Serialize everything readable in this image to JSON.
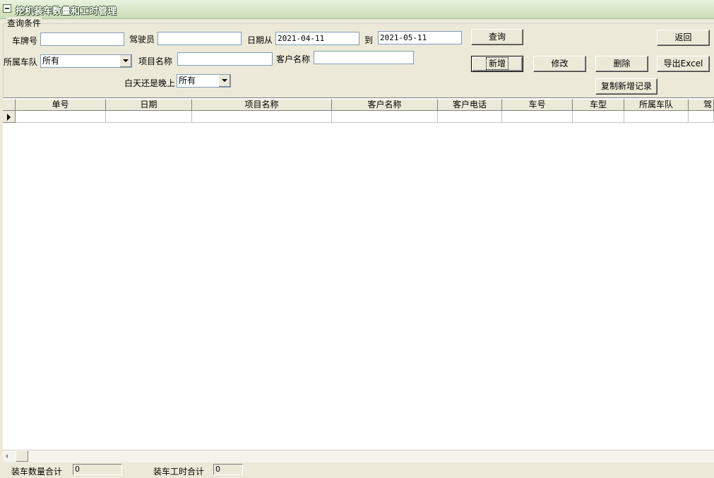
{
  "window": {
    "title": "挖机装车数量和工时管理"
  },
  "query": {
    "group_label": "查询条件",
    "plate_label": "车牌号",
    "plate_value": "",
    "driver_label": "驾驶员",
    "driver_value": "",
    "date_from_label": "日期从",
    "date_from_value": "2021-04-11",
    "date_to_label": "到",
    "date_to_value": "2021-05-11",
    "fleet_label": "所属车队",
    "fleet_value": "所有",
    "project_label": "项目名称",
    "project_value": "",
    "customer_label": "客户名称",
    "customer_value": "",
    "daynight_label": "白天还是晚上",
    "daynight_value": "所有"
  },
  "buttons": {
    "query": "查询",
    "back": "返回",
    "add": "新增",
    "edit": "修改",
    "delete": "删除",
    "export": "导出Excel",
    "copy_add": "复制新增记录"
  },
  "grid": {
    "columns": [
      "单号",
      "日期",
      "项目名称",
      "客户名称",
      "客户电话",
      "车号",
      "车型",
      "所属车队",
      "驾"
    ],
    "rows": [
      [
        "",
        "",
        "",
        "",
        "",
        "",
        "",
        "",
        ""
      ]
    ]
  },
  "status": {
    "load_count_label": "装车数量合计",
    "load_count_value": "0",
    "load_hours_label": "装车工时合计",
    "load_hours_value": "0"
  }
}
